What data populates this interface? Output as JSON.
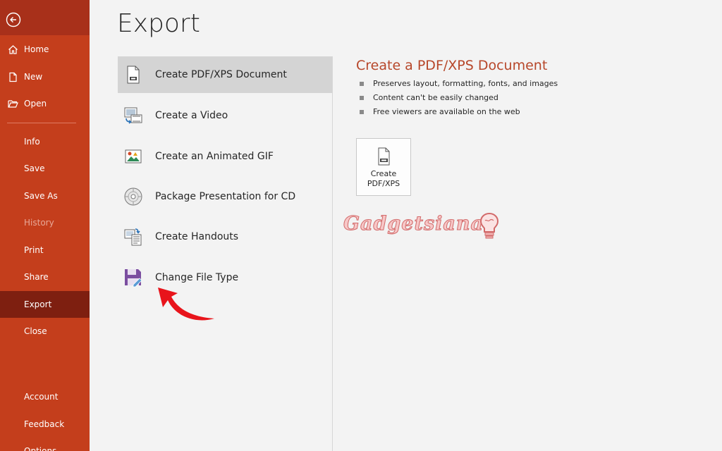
{
  "sidebar": {
    "items": [
      {
        "label": "Home"
      },
      {
        "label": "New"
      },
      {
        "label": "Open"
      },
      {
        "label": "Info"
      },
      {
        "label": "Save"
      },
      {
        "label": "Save As"
      },
      {
        "label": "History"
      },
      {
        "label": "Print"
      },
      {
        "label": "Share"
      },
      {
        "label": "Export"
      },
      {
        "label": "Close"
      },
      {
        "label": "Account"
      },
      {
        "label": "Feedback"
      },
      {
        "label": "Options"
      }
    ],
    "active_item": "Export",
    "disabled_item": "History"
  },
  "page": {
    "title": "Export"
  },
  "options": [
    {
      "label": "Create PDF/XPS Document",
      "icon": "pdf-document-icon"
    },
    {
      "label": "Create a Video",
      "icon": "video-icon"
    },
    {
      "label": "Create an Animated GIF",
      "icon": "animated-gif-icon"
    },
    {
      "label": "Package Presentation for CD",
      "icon": "cd-icon"
    },
    {
      "label": "Create Handouts",
      "icon": "handouts-icon"
    },
    {
      "label": "Change File Type",
      "icon": "change-file-type-icon"
    }
  ],
  "detail": {
    "title": "Create a PDF/XPS Document",
    "bullets": [
      "Preserves layout, formatting, fonts, and images",
      "Content can't be easily changed",
      "Free viewers are available on the web"
    ],
    "button_line1": "Create",
    "button_line2": "PDF/XPS"
  },
  "watermark": {
    "text": "Gadgetsiana"
  },
  "colors": {
    "sidebar": "#c43e1c",
    "sidebar_active": "#7e1f10",
    "accent": "#b7472a",
    "selected_option": "#d4d4d4",
    "arrow": "#e8141b"
  }
}
